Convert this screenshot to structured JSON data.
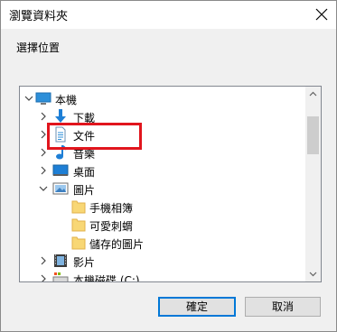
{
  "dialog": {
    "title": "瀏覽資料夾",
    "prompt": "選擇位置",
    "buttons": {
      "ok": "確定",
      "cancel": "取消"
    }
  },
  "tree": {
    "items": [
      {
        "label": "本機",
        "icon": "this-pc-icon",
        "expand": "expanded"
      },
      {
        "label": "下載",
        "icon": "downloads-icon",
        "expand": "collapsed"
      },
      {
        "label": "文件",
        "icon": "documents-icon",
        "expand": "collapsed"
      },
      {
        "label": "音樂",
        "icon": "music-icon",
        "expand": "collapsed"
      },
      {
        "label": "桌面",
        "icon": "desktop-icon",
        "expand": "collapsed"
      },
      {
        "label": "圖片",
        "icon": "pictures-icon",
        "expand": "expanded"
      },
      {
        "label": "手機相簿",
        "icon": "folder-icon",
        "expand": "none"
      },
      {
        "label": "可愛刺蝟",
        "icon": "folder-icon",
        "expand": "none",
        "highlighted": true
      },
      {
        "label": "儲存的圖片",
        "icon": "folder-icon",
        "expand": "none"
      },
      {
        "label": "影片",
        "icon": "videos-icon",
        "expand": "collapsed"
      },
      {
        "label": "本機磁碟 (C:)",
        "icon": "drive-icon",
        "expand": "collapsed"
      }
    ]
  },
  "colors": {
    "highlight_border": "#e1151d",
    "folder_yellow": "#f8d775",
    "accent_blue": "#0078d7"
  }
}
